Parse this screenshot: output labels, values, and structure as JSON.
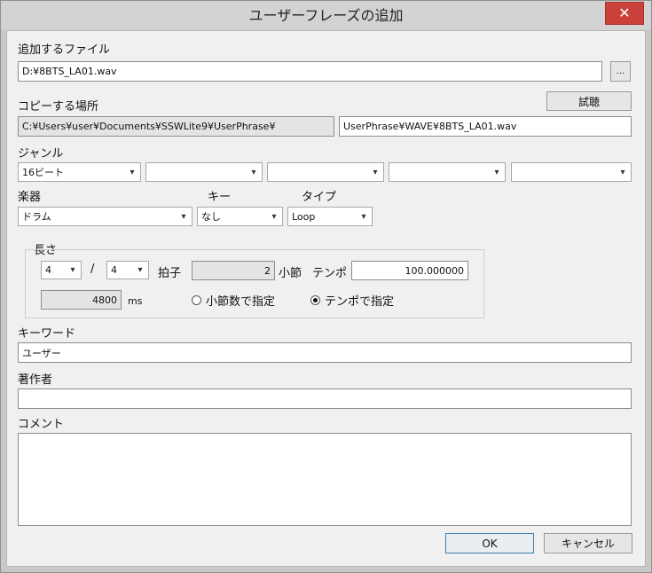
{
  "window": {
    "title": "ユーザーフレーズの追加",
    "close_glyph": "✕"
  },
  "file": {
    "label": "追加するファイル",
    "value": "D:¥8BTS_LA01.wav",
    "browse_label": "..."
  },
  "copy": {
    "label": "コピーする場所",
    "preview_label": "試聴",
    "base_path": "C:¥Users¥user¥Documents¥SSWLite9¥UserPhrase¥",
    "relative_path": "UserPhrase¥WAVE¥8BTS_LA01.wav"
  },
  "genre": {
    "label": "ジャンル",
    "values": [
      "16ビート",
      "",
      "",
      "",
      ""
    ]
  },
  "instrument": {
    "label": "楽器",
    "value": "ドラム"
  },
  "key": {
    "label": "キー",
    "value": "なし"
  },
  "type": {
    "label": "タイプ",
    "value": "Loop"
  },
  "length": {
    "label": "長さ",
    "beat_num": "4",
    "slash": "/",
    "beat_den": "4",
    "beat_label": "拍子",
    "bars_value": "2",
    "bars_label": "小節",
    "tempo_label": "テンポ",
    "tempo_value": "100.000000",
    "ms_value": "4800",
    "ms_label": "ms",
    "radio_bars": "小節数で指定",
    "radio_tempo": "テンポで指定",
    "selected": "tempo"
  },
  "keyword": {
    "label": "キーワード",
    "value": "ユーザー"
  },
  "author": {
    "label": "著作者",
    "value": ""
  },
  "comment": {
    "label": "コメント",
    "value": ""
  },
  "footer": {
    "ok_label": "OK",
    "cancel_label": "キャンセル"
  },
  "colors": {
    "close_button": "#c9413a",
    "default_button_border": "#3c7fb1"
  }
}
